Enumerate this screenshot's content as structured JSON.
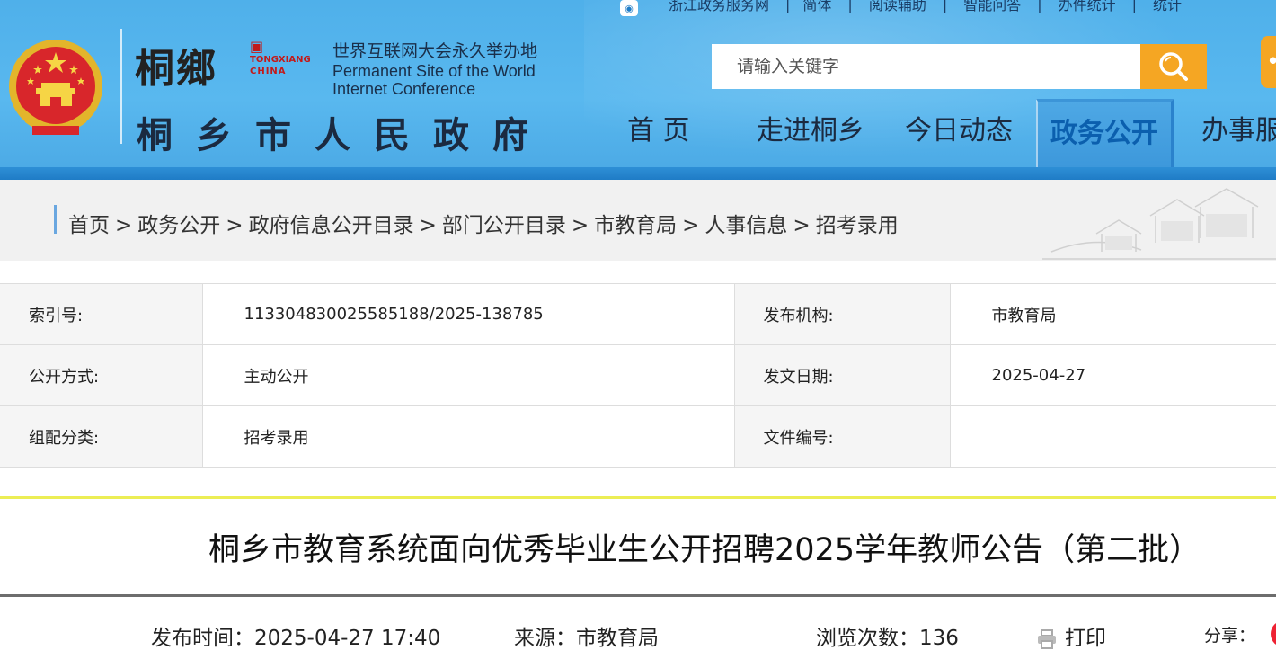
{
  "topbar": {
    "links": [
      "浙江政务服务网",
      "简体",
      "阅读辅助",
      "智能问答",
      "办件统计",
      "统计"
    ]
  },
  "header": {
    "logo_calligraphy": "桐鄉",
    "logo_mark_lines": [
      "TONGXIANG",
      "CHINA"
    ],
    "wic_cn": "世界互联网大会永久举办地",
    "wic_en_line1": "Permanent Site of the World",
    "wic_en_line2": "Internet Conference",
    "site_name": "桐乡市人民政府",
    "emblem": "national-emblem-icon"
  },
  "search": {
    "placeholder": "请输入关键字",
    "button_icon": "search-icon"
  },
  "nav": {
    "items": [
      "首 页",
      "走进桐乡",
      "今日动态",
      "政务公开",
      "办事服"
    ],
    "active": "政务公开"
  },
  "breadcrumb": {
    "items": [
      "首页",
      "政务公开",
      "政府信息公开目录",
      "部门公开目录",
      "市教育局",
      "人事信息",
      "招考录用"
    ],
    "separator": ">"
  },
  "meta": {
    "index_label": "索引号:",
    "index_value": "113304830025585188/2025-138785",
    "publisher_label": "发布机构:",
    "publisher_value": "市教育局",
    "open_mode_label": "公开方式:",
    "open_mode_value": "主动公开",
    "date_label": "发文日期:",
    "date_value": "2025-04-27",
    "category_label": "组配分类:",
    "category_value": "招考录用",
    "doc_no_label": "文件编号:",
    "doc_no_value": ""
  },
  "article": {
    "title": "桐乡市教育系统面向优秀毕业生公开招聘2025学年教师公告（第二批）",
    "publish_time": "发布时间：2025-04-27  17:40",
    "source": "来源：市教育局",
    "views": "浏览次数：136",
    "print_label": "打印",
    "share_label": "分享："
  },
  "colors": {
    "header_blue": "#4fb0ea",
    "search_orange": "#f5a623",
    "active_nav_text": "#0b5fae",
    "title_top_rule": "#ecee55"
  }
}
